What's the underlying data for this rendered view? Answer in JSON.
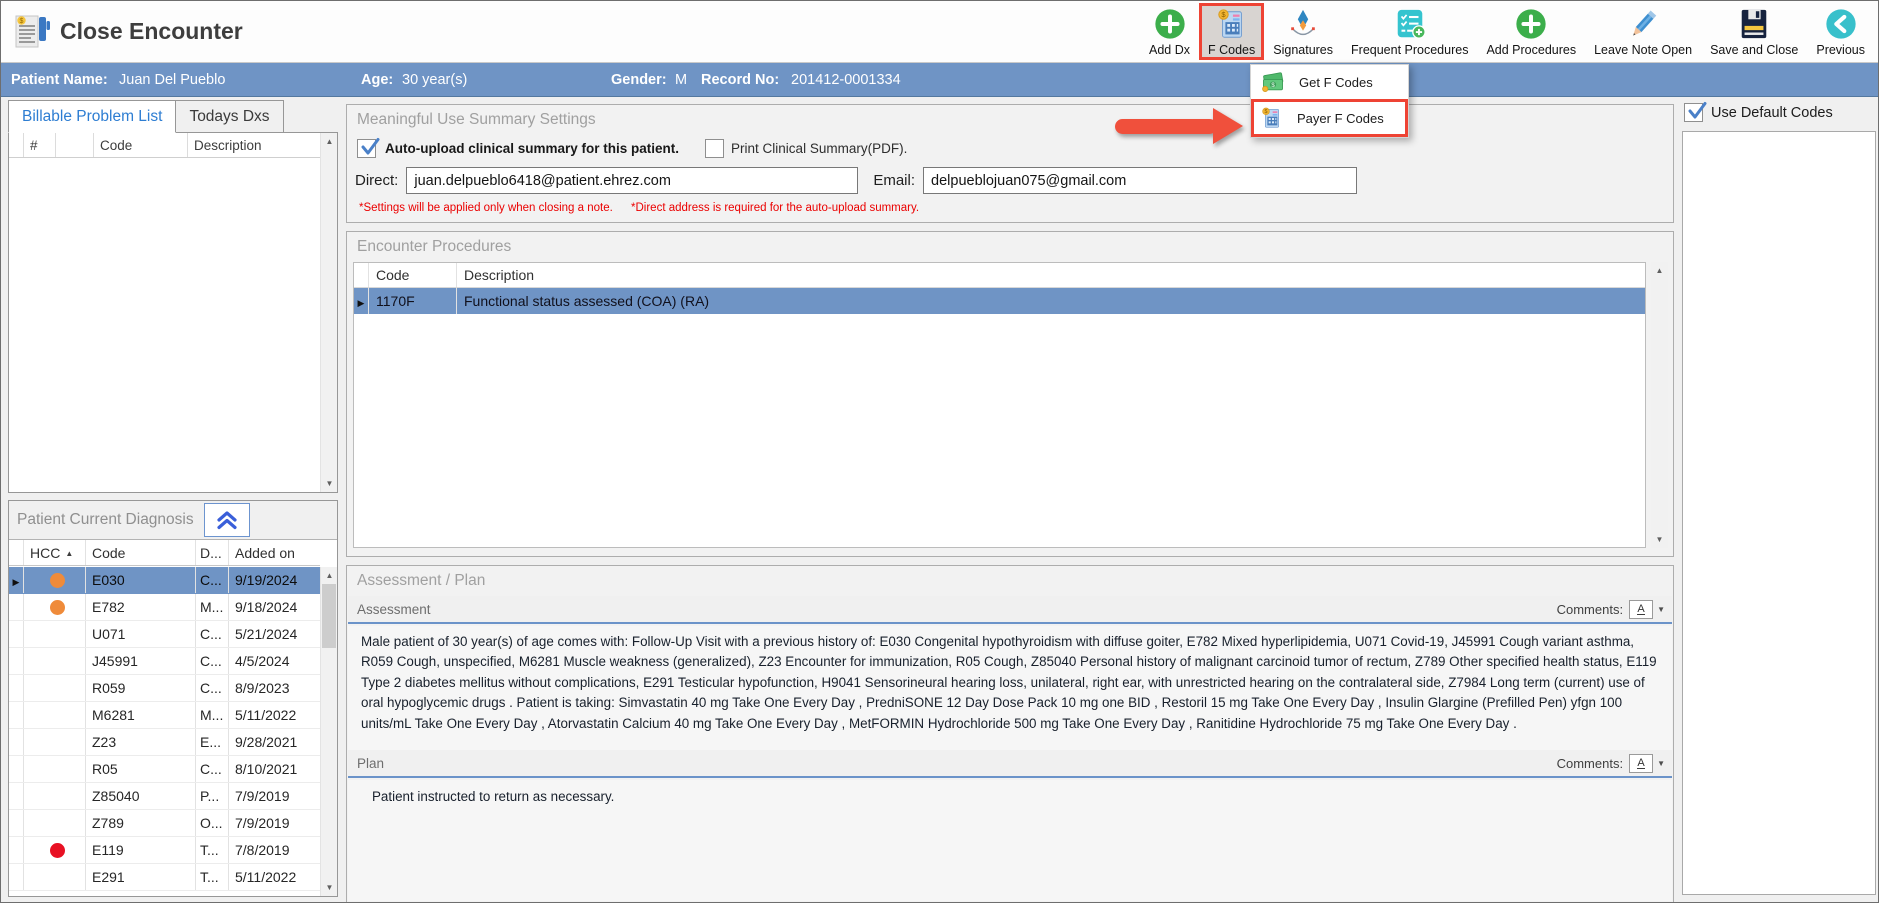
{
  "window": {
    "title": "Close Encounter"
  },
  "toolbar": {
    "buttons": [
      {
        "label": "Add Dx"
      },
      {
        "label": "F Codes"
      },
      {
        "label": "Signatures"
      },
      {
        "label": "Frequent Procedures"
      },
      {
        "label": "Add Procedures"
      },
      {
        "label": "Leave Note Open"
      },
      {
        "label": "Save and Close"
      },
      {
        "label": "Previous"
      }
    ]
  },
  "f_codes_menu": {
    "items": [
      {
        "label": "Get F Codes"
      },
      {
        "label": "Payer F Codes",
        "highlighted": true
      }
    ]
  },
  "patient_bar": {
    "name_label": "Patient Name:",
    "name": "Juan Del Pueblo",
    "age_label": "Age:",
    "age": "30 year(s)",
    "gender_label": "Gender:",
    "gender": "M",
    "record_label": "Record No:",
    "record": "201412-0001334"
  },
  "left_panel": {
    "tabs": [
      {
        "label": "Billable Problem List",
        "active": true
      },
      {
        "label": "Todays Dxs",
        "active": false
      }
    ],
    "problem_table": {
      "headers": {
        "num": "#",
        "code": "Code",
        "description": "Description"
      },
      "rows": []
    },
    "current_diagnosis": {
      "title": "Patient Current Diagnosis",
      "headers": {
        "hcc": "HCC",
        "code": "Code",
        "d": "D...",
        "added_on": "Added on"
      },
      "sort": {
        "column": "HCC",
        "direction": "asc"
      },
      "rows": [
        {
          "hcc": "orange",
          "code": "E030",
          "d": "C...",
          "added": "9/19/2024",
          "selected": true
        },
        {
          "hcc": "orange",
          "code": "E782",
          "d": "M...",
          "added": "9/18/2024"
        },
        {
          "hcc": "",
          "code": "U071",
          "d": "C...",
          "added": "5/21/2024"
        },
        {
          "hcc": "",
          "code": "J45991",
          "d": "C...",
          "added": "4/5/2024"
        },
        {
          "hcc": "",
          "code": "R059",
          "d": "C...",
          "added": "8/9/2023"
        },
        {
          "hcc": "",
          "code": "M6281",
          "d": "M...",
          "added": "5/11/2022"
        },
        {
          "hcc": "",
          "code": "Z23",
          "d": "E...",
          "added": "9/28/2021"
        },
        {
          "hcc": "",
          "code": "R05",
          "d": "C...",
          "added": "8/10/2021"
        },
        {
          "hcc": "",
          "code": "Z85040",
          "d": "P...",
          "added": "7/9/2019"
        },
        {
          "hcc": "",
          "code": "Z789",
          "d": "O...",
          "added": "7/9/2019"
        },
        {
          "hcc": "red",
          "code": "E119",
          "d": "T...",
          "added": "7/8/2019"
        },
        {
          "hcc": "",
          "code": "E291",
          "d": "T...",
          "added": "5/11/2022"
        }
      ]
    }
  },
  "mu_settings": {
    "title": "Meaningful Use Summary Settings",
    "auto_upload_label": "Auto-upload clinical summary for this patient.",
    "auto_upload_checked": true,
    "print_label": "Print Clinical Summary(PDF).",
    "print_checked": false,
    "direct_label": "Direct:",
    "direct_value": "juan.delpueblo6418@patient.ehrez.com",
    "email_label": "Email:",
    "email_value": "delpueblojuan075@gmail.com",
    "note1": "*Settings will be applied only when closing a note.",
    "note2": "*Direct address is required for the auto-upload summary."
  },
  "encounter_procedures": {
    "title": "Encounter Procedures",
    "headers": {
      "code": "Code",
      "description": "Description"
    },
    "rows": [
      {
        "code": "1170F",
        "description": "Functional status assessed (COA) (RA)",
        "selected": true
      }
    ]
  },
  "assessment_plan": {
    "title": "Assessment / Plan",
    "assessment_label": "Assessment",
    "comments_label": "Comments:",
    "assessment_text": "Male patient of 30 year(s) of age comes with: Follow-Up Visit  with a previous history of: E030 Congenital hypothyroidism with diffuse goiter, E782 Mixed hyperlipidemia, U071 Covid-19, J45991 Cough variant asthma, R059 Cough, unspecified, M6281 Muscle weakness (generalized), Z23 Encounter for immunization, R05 Cough, Z85040 Personal history of malignant carcinoid tumor of rectum, Z789 Other specified health status, E119 Type 2 diabetes mellitus without complications, E291 Testicular hypofunction, H9041 Sensorineural hearing loss, unilateral, right ear, with unrestricted hearing on the contralateral side, Z7984 Long term (current) use of oral hypoglycemic drugs .  Patient is taking: Simvastatin 40 mg Take One Every Day , PredniSONE 12 Day Dose Pack 10 mg one BID , Restoril 15 mg Take One Every Day , Insulin Glargine (Prefilled Pen) yfgn 100 units/mL Take One Every Day , Atorvastatin Calcium 40 mg Take One Every Day , MetFORMIN Hydrochloride 500 mg Take One Every Day , Ranitidine Hydrochloride 75 mg Take One Every Day  .",
    "plan_label": "Plan",
    "plan_text": "Patient instructed to return as necessary."
  },
  "right_panel": {
    "use_default_codes_label": "Use Default Codes",
    "checked": true
  },
  "colors": {
    "patient_bar": "#6f94c5",
    "selection": "#6f94c5",
    "annotation_red": "#ee4334",
    "hcc_orange": "#ef8b3a",
    "hcc_red": "#e81123",
    "accent_blue": "#6b93c9",
    "tab_active_text": "#2d7dd2"
  }
}
